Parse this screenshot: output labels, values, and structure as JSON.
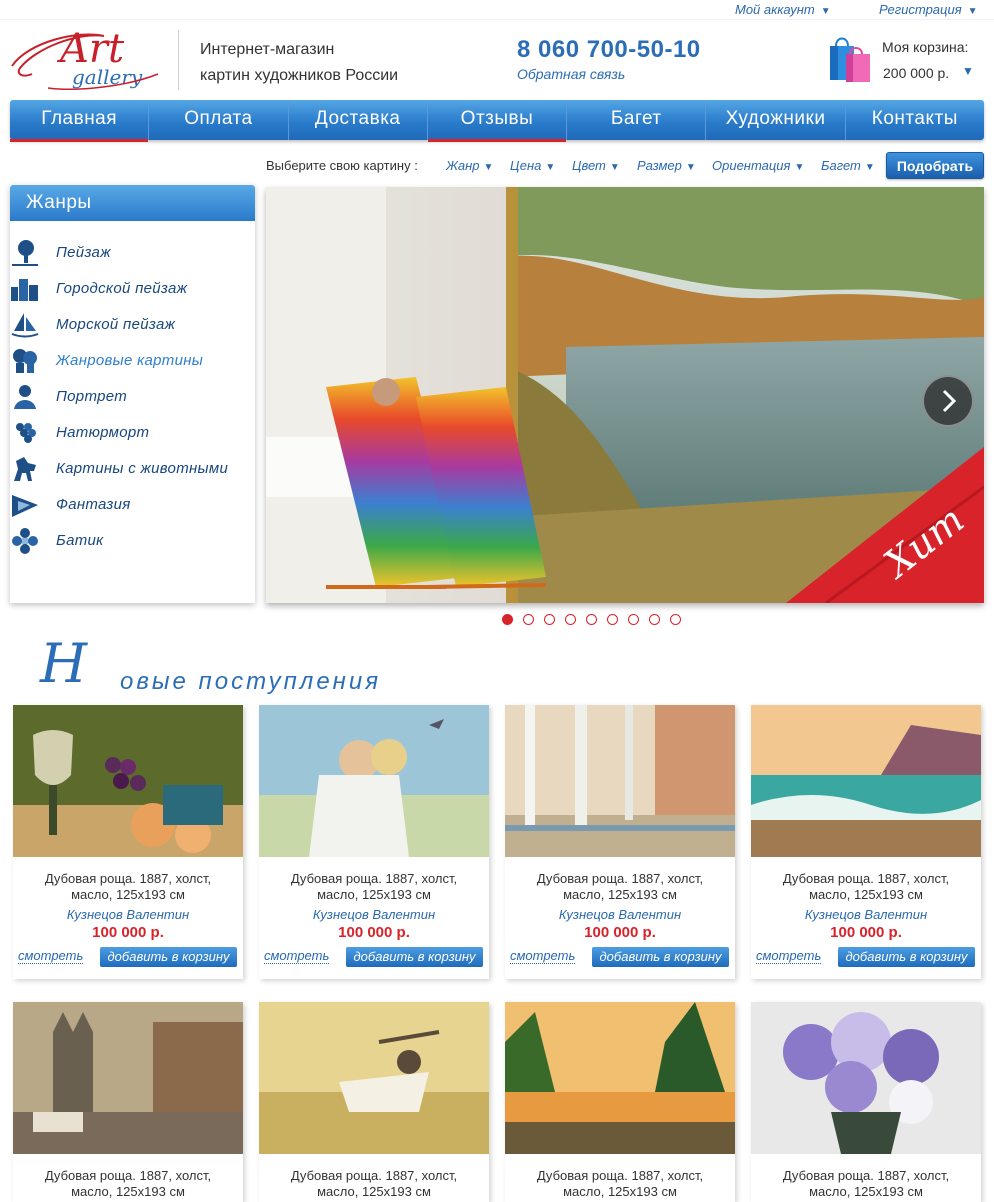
{
  "topbar": {
    "account": "Мой аккаунт",
    "register": "Регистрация"
  },
  "header": {
    "logo_word1": "Art",
    "logo_word2": "gallery",
    "desc_line1": "Интернет-магазин",
    "desc_line2": "картин художников России",
    "phone": "8 060 700-50-10",
    "feedback": "Обратная связь",
    "cart_label": "Моя корзина:",
    "cart_total": "200 000 р."
  },
  "nav": {
    "items": [
      "Главная",
      "Оплата",
      "Доставка",
      "Отзывы",
      "Багет",
      "Художники",
      "Контакты"
    ],
    "active": [
      "Главная",
      "Отзывы"
    ]
  },
  "filter": {
    "label": "Выберите свою картину :",
    "options": [
      "Жанр",
      "Цена",
      "Цвет",
      "Размер",
      "Ориентация",
      "Багет"
    ],
    "button": "Подобрать"
  },
  "sidebar": {
    "title": "Жанры",
    "items": [
      {
        "label": "Пейзаж",
        "icon": "tree-icon"
      },
      {
        "label": "Городской пейзаж",
        "icon": "city-icon"
      },
      {
        "label": "Морской пейзаж",
        "icon": "sailboat-icon"
      },
      {
        "label": "Жанровые картины",
        "icon": "couple-icon"
      },
      {
        "label": "Портрет",
        "icon": "portrait-icon"
      },
      {
        "label": "Натюрморт",
        "icon": "grapes-icon"
      },
      {
        "label": "Картины с животными",
        "icon": "horse-icon"
      },
      {
        "label": "Фантазия",
        "icon": "fantasy-icon"
      },
      {
        "label": "Батик",
        "icon": "flower-icon"
      }
    ]
  },
  "slider": {
    "badge": "Хит",
    "dots_total": 9,
    "active_dot": 1
  },
  "section": {
    "title_cap": "Н",
    "title_rest": "овые поступления"
  },
  "products": [
    {
      "title": "Дубовая роща. 1887, холст, масло, 125х193 см",
      "artist": "Кузнецов Валентин",
      "price": "100 000 р.",
      "view": "смотреть",
      "add": "добавить в корзину"
    },
    {
      "title": "Дубовая роща. 1887, холст, масло, 125х193 см",
      "artist": "Кузнецов Валентин",
      "price": "100 000 р.",
      "view": "смотреть",
      "add": "добавить в корзину"
    },
    {
      "title": "Дубовая роща. 1887, холст, масло, 125х193 см",
      "artist": "Кузнецов Валентин",
      "price": "100 000 р.",
      "view": "смотреть",
      "add": "добавить в корзину"
    },
    {
      "title": "Дубовая роща. 1887, холст, масло, 125х193 см",
      "artist": "Кузнецов Валентин",
      "price": "100 000 р.",
      "view": "смотреть",
      "add": "добавить в корзину"
    },
    {
      "title": "Дубовая роща. 1887, холст, масло, 125х193 см"
    },
    {
      "title": "Дубовая роща. 1887, холст, масло, 125х193 см"
    },
    {
      "title": "Дубовая роща. 1887, холст, масло, 125х193 см"
    },
    {
      "title": "Дубовая роща. 1887, холст, масло, 125х193 см"
    }
  ],
  "colors": {
    "brand_blue": "#2b6db7",
    "accent_red": "#d8232a"
  }
}
